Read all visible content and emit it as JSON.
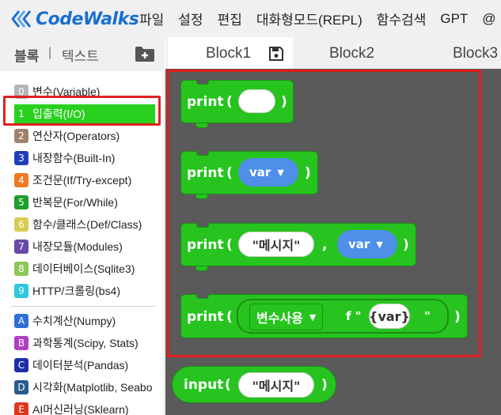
{
  "app": {
    "logo_text": "CodeWalks"
  },
  "menu": [
    {
      "label": "파일"
    },
    {
      "label": "설정"
    },
    {
      "label": "편집"
    },
    {
      "label": "대화형모드(REPL)"
    },
    {
      "label": "함수검색"
    },
    {
      "label": "GPT"
    },
    {
      "label": "@"
    }
  ],
  "sidebar": {
    "tab_blocks": "블록",
    "separator": "|",
    "tab_text": "텍스트",
    "categories": [
      {
        "num": "0",
        "label": "변수(Variable)",
        "color": "#b5b5b5"
      },
      {
        "num": "1",
        "label": "입출력(I/O)",
        "color": "#29d11f"
      },
      {
        "num": "2",
        "label": "연산자(Operators)",
        "color": "#a0826d"
      },
      {
        "num": "3",
        "label": "내장함수(Built-In)",
        "color": "#1f3fb8"
      },
      {
        "num": "4",
        "label": "조건문(If/Try-except)",
        "color": "#f07a22"
      },
      {
        "num": "5",
        "label": "반복문(For/While)",
        "color": "#1e9e2a"
      },
      {
        "num": "6",
        "label": "함수/클래스(Def/Class)",
        "color": "#d9cc52"
      },
      {
        "num": "7",
        "label": "내장모듈(Modules)",
        "color": "#6a4aa8"
      },
      {
        "num": "8",
        "label": "데이터베이스(Sqlite3)",
        "color": "#8fc65a"
      },
      {
        "num": "9",
        "label": "HTTP/크롤링(bs4)",
        "color": "#2ec7e0"
      },
      {
        "num": "A",
        "label": "수치계산(Numpy)",
        "color": "#2f6fd6"
      },
      {
        "num": "B",
        "label": "과학통계(Scipy, Stats)",
        "color": "#b03fc4"
      },
      {
        "num": "C",
        "label": "데이터분석(Pandas)",
        "color": "#1c2fa8"
      },
      {
        "num": "D",
        "label": "시각화(Matplotlib, Seabo",
        "color": "#2a5b8c"
      },
      {
        "num": "E",
        "label": "AI머신러닝(Sklearn)",
        "color": "#e0341c"
      }
    ]
  },
  "tabs": [
    {
      "label": "Block1"
    },
    {
      "label": "Block2"
    },
    {
      "label": "Block3"
    }
  ],
  "blocks": {
    "print_kw": "print",
    "input_kw": "input",
    "open_paren": "(",
    "close_paren": ")",
    "comma": ",",
    "var_label": "var",
    "message_label": "\"메시지\"",
    "fstring_var_select": "변수사용",
    "fstring_prefix": "f \"",
    "fstring_var_braces": "{var}",
    "fstring_end_quote": "\""
  },
  "colors": {
    "block_green": "#27c41f",
    "var_blue": "#4f8fea",
    "workspace": "#5a5a5a",
    "highlight_red": "#e01c1c"
  }
}
